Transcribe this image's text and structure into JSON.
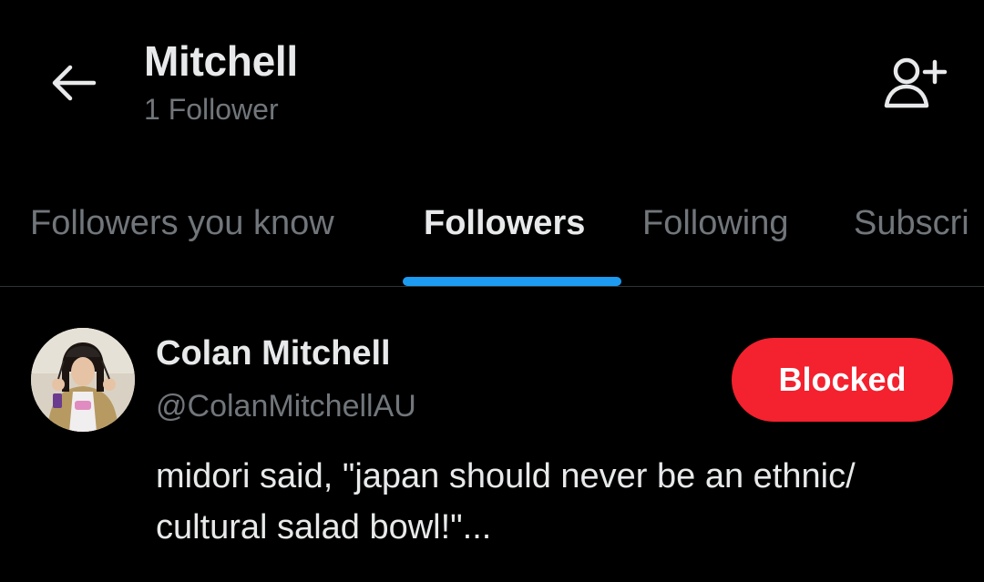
{
  "header": {
    "title": "Mitchell",
    "subtitle": "1 Follower",
    "back_icon": "arrow-left-icon",
    "add_user_icon": "person-add-icon"
  },
  "tabs": [
    {
      "label": "Followers you know",
      "active": false
    },
    {
      "label": "Followers",
      "active": true
    },
    {
      "label": "Following",
      "active": false
    },
    {
      "label": "Subscri",
      "active": false
    }
  ],
  "colors": {
    "background": "#000000",
    "text_primary": "#e7e9ea",
    "text_secondary": "#71767b",
    "accent": "#1d9bf0",
    "blocked": "#f4212e",
    "divider": "#2f3336"
  },
  "follower": {
    "name": "Colan Mitchell",
    "handle": "@ColanMitchellAU",
    "button_label": "Blocked",
    "bio": "midori said, \"japan should never be an ethnic/ cultural salad bowl!\"..."
  }
}
